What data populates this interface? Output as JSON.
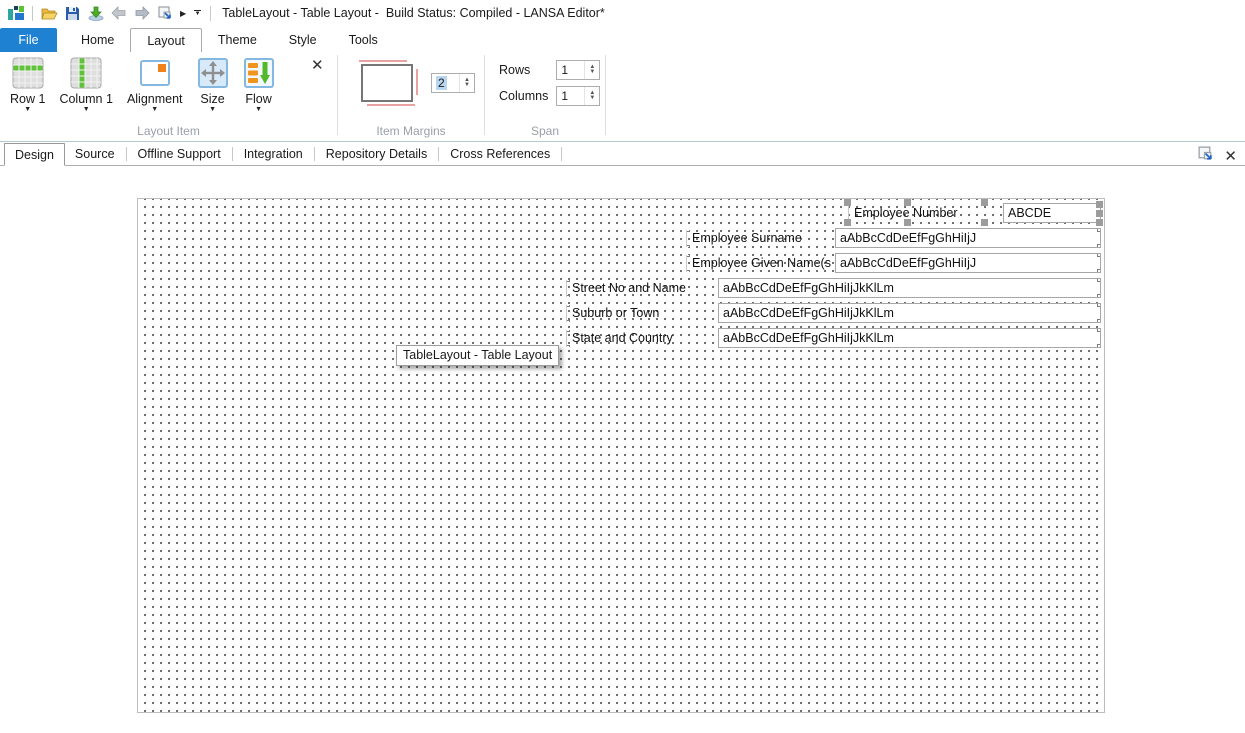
{
  "titlebar": {
    "title": "TableLayout - Table Layout -  Build Status: Compiled - LANSA Editor*"
  },
  "icons": {
    "more_triangle": "▶",
    "qat_caret": "▼",
    "dropdown_caret": "▼",
    "spin_up": "▲",
    "spin_down": "▼",
    "close_x": "✕"
  },
  "ribbon": {
    "tabs": [
      {
        "label": "File"
      },
      {
        "label": "Home"
      },
      {
        "label": "Layout"
      },
      {
        "label": "Theme"
      },
      {
        "label": "Style"
      },
      {
        "label": "Tools"
      }
    ],
    "groups": {
      "layout_item": {
        "label": "Layout Item",
        "buttons": [
          {
            "label": "Row 1"
          },
          {
            "label": "Column 1"
          },
          {
            "label": "Alignment"
          },
          {
            "label": "Size"
          },
          {
            "label": "Flow"
          }
        ]
      },
      "item_margins": {
        "label": "Item Margins",
        "value": "2"
      },
      "span": {
        "label": "Span",
        "rows_label": "Rows",
        "rows_value": "1",
        "columns_label": "Columns",
        "columns_value": "1"
      }
    }
  },
  "doc_tabs": [
    {
      "label": "Design"
    },
    {
      "label": "Source"
    },
    {
      "label": "Offline Support"
    },
    {
      "label": "Integration"
    },
    {
      "label": "Repository Details"
    },
    {
      "label": "Cross References"
    }
  ],
  "canvas": {
    "tooltip": "TableLayout - Table Layout",
    "fields": [
      {
        "label": "Employee Number",
        "value": "ABCDE"
      },
      {
        "label": "Employee Surname",
        "value": "aAbBcCdDeEfFgGhHiIjJ"
      },
      {
        "label": "Employee Given Name(s",
        "value": "aAbBcCdDeEfFgGhHiIjJ"
      },
      {
        "label": "Street No and Name",
        "value": "aAbBcCdDeEfFgGhHiIjJkKlLm"
      },
      {
        "label": "Suburb or Town",
        "value": "aAbBcCdDeEfFgGhHiIjJkKlLm"
      },
      {
        "label": "State and Country",
        "value": "aAbBcCdDeEfFgGhHiIjJkKlLm"
      }
    ]
  },
  "colors": {
    "accent_blue": "#1e81d2",
    "selection_blue": "#b8d6f0",
    "green": "#5fc238",
    "orange": "#f0821e",
    "ribbon_border": "#b8c8d2"
  }
}
